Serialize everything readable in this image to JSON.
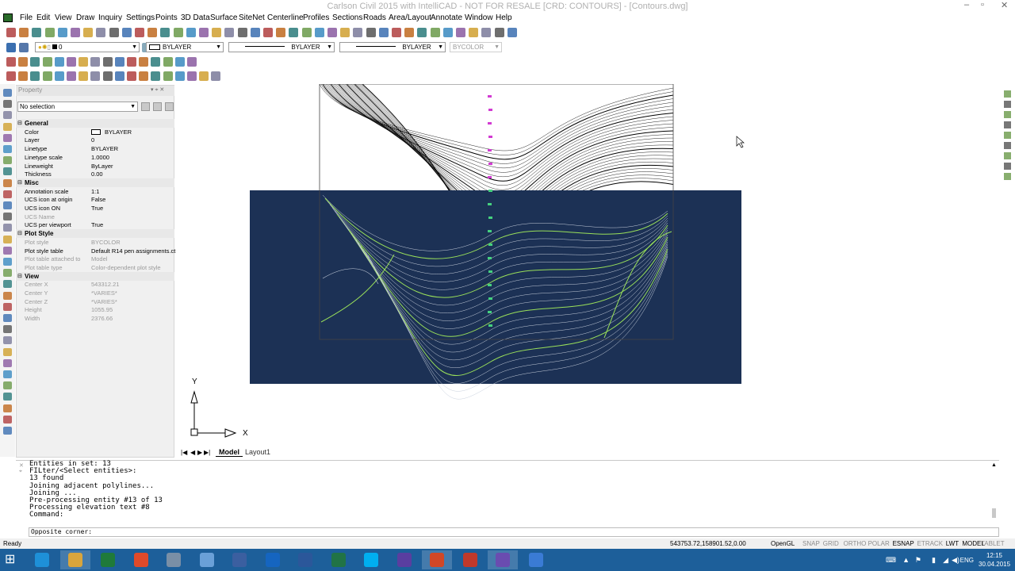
{
  "window": {
    "title": "Carlson Civil 2015 with IntelliCAD - NOT FOR RESALE [CRD: CONTOURS] - [Contours.dwg]",
    "minimize_glyph": "–",
    "restore_glyph": "▫",
    "close_glyph": "✕"
  },
  "menu": [
    "File",
    "Edit",
    "View",
    "Draw",
    "Inquiry",
    "Settings",
    "Points",
    "3D Data",
    "Surface",
    "SiteNet",
    "Centerline",
    "Profiles",
    "Sections",
    "Roads",
    "Area/Layout",
    "Annotate",
    "Window",
    "Help"
  ],
  "toolbar2": {
    "layer_value": "0",
    "color_value": "BYLAYER",
    "linetype_value": "BYLAYER",
    "lineweight_value": "BYLAYER",
    "plotstyle_value": "BYCOLOR"
  },
  "property_panel": {
    "title": "Property",
    "selection": "No selection",
    "categories": [
      {
        "name": "General",
        "rows": [
          {
            "key": "Color",
            "value": "BYLAYER",
            "disabled": false,
            "swatch": true
          },
          {
            "key": "Layer",
            "value": "0",
            "disabled": false
          },
          {
            "key": "Linetype",
            "value": "BYLAYER",
            "disabled": false
          },
          {
            "key": "Linetype scale",
            "value": "1.0000",
            "disabled": false
          },
          {
            "key": "Lineweight",
            "value": "ByLayer",
            "disabled": false
          },
          {
            "key": "Thickness",
            "value": "0.00",
            "disabled": false
          }
        ]
      },
      {
        "name": "Misc",
        "rows": [
          {
            "key": "Annotation scale",
            "value": "1:1",
            "disabled": false
          },
          {
            "key": "UCS icon at origin",
            "value": "False",
            "disabled": false
          },
          {
            "key": "UCS icon ON",
            "value": "True",
            "disabled": false
          },
          {
            "key": "UCS Name",
            "value": "",
            "disabled": true
          },
          {
            "key": "UCS per viewport",
            "value": "True",
            "disabled": false
          }
        ]
      },
      {
        "name": "Plot Style",
        "rows": [
          {
            "key": "Plot style",
            "value": "BYCOLOR",
            "disabled": true
          },
          {
            "key": "Plot style table",
            "value": "Default R14 pen assignments.ct",
            "disabled": false
          },
          {
            "key": "Plot table attached to",
            "value": "Model",
            "disabled": true
          },
          {
            "key": "Plot table type",
            "value": "Color-dependent plot style",
            "disabled": true
          }
        ]
      },
      {
        "name": "View",
        "rows": [
          {
            "key": "Center X",
            "value": "543312.21",
            "disabled": true
          },
          {
            "key": "Center Y",
            "value": "*VARIES*",
            "disabled": true
          },
          {
            "key": "Center Z",
            "value": "*VARIES*",
            "disabled": true
          },
          {
            "key": "Height",
            "value": "1055.95",
            "disabled": true
          },
          {
            "key": "Width",
            "value": "2376.66",
            "disabled": true
          }
        ]
      }
    ]
  },
  "ucs": {
    "x_label": "X",
    "y_label": "Y"
  },
  "tabs": {
    "model": "Model",
    "layout1": "Layout1"
  },
  "command_history": [
    "Entities in set: 13",
    "FILter/<Select entities>:",
    "13 found",
    "Joining adjacent polylines...",
    "Joining ...",
    "Pre-processing entity #13 of 13",
    "Processing elevation text #8",
    "Command:"
  ],
  "command_prompt": "Opposite corner:",
  "status": {
    "ready": "Ready",
    "coords": "543753.72,158901.52,0.00",
    "render": "OpenGL",
    "toggles": [
      {
        "label": "SNAP",
        "on": false
      },
      {
        "label": "GRID",
        "on": false
      },
      {
        "label": "ORTHO",
        "on": false
      },
      {
        "label": "POLAR",
        "on": false
      },
      {
        "label": "ESNAP",
        "on": true
      },
      {
        "label": "ETRACK",
        "on": false
      },
      {
        "label": "LWT",
        "on": true
      },
      {
        "label": "MODEL",
        "on": true
      }
    ],
    "tablet": "TABLET"
  },
  "taskbar": {
    "apps": [
      "start",
      "ie",
      "explorer",
      "excel-green",
      "chrome",
      "browser-2",
      "calculator",
      "tool",
      "outlook",
      "word",
      "excel",
      "skype",
      "carlson",
      "powerpoint",
      "autocad",
      "carlson-2",
      "settings"
    ],
    "lang": "ENG",
    "time": "12:15",
    "date": "30.04.2015"
  },
  "colors": {
    "selection_window": "#1c3155",
    "contour_white": "#c8d0dd",
    "contour_green": "#9ae05a",
    "label_magenta": "#d23bd2",
    "label_green": "#45d17f",
    "taskbar": "#1d5f9a"
  }
}
